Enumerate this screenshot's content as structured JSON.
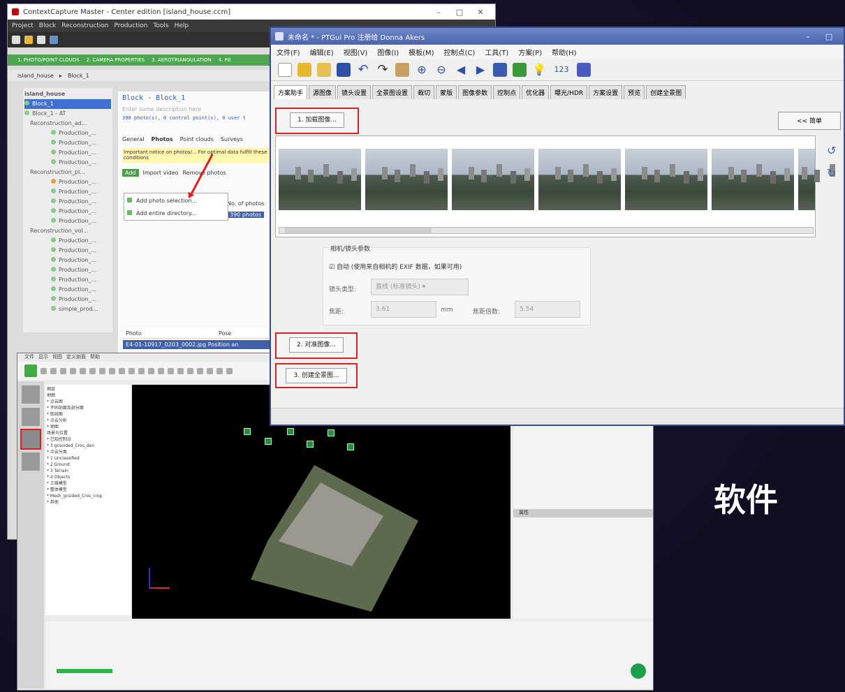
{
  "contextcapture": {
    "title": "ContextCapture Master - Center edition [island_house.ccm]",
    "menu": [
      "Project",
      "Block",
      "Reconstruction",
      "Production",
      "Tools",
      "Help"
    ],
    "steps": [
      "1. PHOTO/POINT CLOUDS",
      "2. CAMERA PROPERTIES",
      "3. AEROTRIANGULATION",
      "4. RE"
    ],
    "crumbs": [
      "island_house",
      "Block_1"
    ],
    "tree": [
      {
        "label": "island_house",
        "sel": false
      },
      {
        "label": "Block_1",
        "sel": true
      },
      {
        "label": "Block_1 - AT",
        "sel": false
      },
      {
        "label": "Reconstruction_ad...",
        "sel": false
      },
      {
        "label": "Production_...",
        "sel": false
      },
      {
        "label": "Production_...",
        "sel": false
      },
      {
        "label": "Production_...",
        "sel": false
      },
      {
        "label": "Production_...",
        "sel": false
      },
      {
        "label": "Reconstruction_pl...",
        "sel": false
      },
      {
        "label": "Production_...",
        "sel": false
      },
      {
        "label": "Production_...",
        "sel": false
      },
      {
        "label": "Production_...",
        "sel": false
      },
      {
        "label": "Production_...",
        "sel": false
      },
      {
        "label": "Production_...",
        "sel": false
      },
      {
        "label": "Reconstruction_vol...",
        "sel": false
      },
      {
        "label": "Production_...",
        "sel": false
      },
      {
        "label": "Production_...",
        "sel": false
      },
      {
        "label": "Production_...",
        "sel": false
      },
      {
        "label": "Production_...",
        "sel": false
      },
      {
        "label": "Production_...",
        "sel": false
      },
      {
        "label": "Production_...",
        "sel": false
      },
      {
        "label": "Production_...",
        "sel": false
      },
      {
        "label": "simple_prod...",
        "sel": false
      }
    ],
    "detail": {
      "heading": "Block - Block_1",
      "subtitle": "Enter some description here",
      "stats": "390 photo(s), 0 control point(s), 0 user t",
      "tabs": [
        "General",
        "Photos",
        "Point clouds",
        "Surveys"
      ],
      "warning": "Important notice on photos/... For optimal data fulfill these conditions",
      "add_button": "Add",
      "import_video": "Import video",
      "remove_photos": "Remove photos",
      "no_photos": "No. of photos",
      "photos_count": "390 photos"
    },
    "dropdown": [
      "Add photo selection...",
      "Add entire directory..."
    ],
    "table_headers": [
      "Photo",
      "Pose"
    ],
    "table_row": [
      "E4-01-10917_0203_0002.jpg",
      "Position an"
    ]
  },
  "viewer3d": {
    "menu": [
      "文件",
      "显示",
      "视图",
      "定义剖面",
      "帮助"
    ],
    "layers": [
      "图层",
      "地图",
      "* 点云图",
      "  * 不同剖面及剖分面",
      "  * 航线图",
      "  * 点云分析",
      "* 地图",
      "  场景与位置",
      "  * 已知控制点",
      "    * 3 gcsoided_Cros_den",
      "* 点云分类",
      "  * 1 Unclassified",
      "  * 2 Ground",
      "  * 3 Terrain",
      "  * 4 Objects",
      "* 三维模型",
      "  * 整体模型",
      "    * Mesh_gcsided_Cros_crop",
      "  * 其他"
    ],
    "right_panel_header": "属性"
  },
  "ptgui": {
    "title": "未命名 * - PTGui Pro 注册给 Donna Akers",
    "menu": [
      "文件(F)",
      "编辑(E)",
      "视图(V)",
      "图像(I)",
      "模板(M)",
      "控制点(C)",
      "工具(T)",
      "方案(P)",
      "帮助(H)"
    ],
    "tabs": [
      "方案助手",
      "源图像",
      "镜头设置",
      "全景图设置",
      "裁切",
      "蒙版",
      "图像参数",
      "控制点",
      "优化器",
      "曝光/HDR",
      "方案设置",
      "预览",
      "创建全景图"
    ],
    "step1": "1. 加载图像...",
    "step2": "2. 对准图像...",
    "step3": "3. 创建全景图...",
    "advanced": "<< 简单",
    "camera_group": "相机/镜头参数",
    "auto_check": "自动 (使用来自相机的 EXIF 数据，如果可用)",
    "lens_type_label": "镜头类型:",
    "lens_type_value": "直线 (标准镜头)",
    "focal_label": "焦距:",
    "focal_value": "3.61",
    "focal_unit": "mm",
    "focal_mult_label": "焦距倍数:",
    "focal_mult_value": "5.54",
    "toolbar_number": "123"
  },
  "caption": "软件"
}
